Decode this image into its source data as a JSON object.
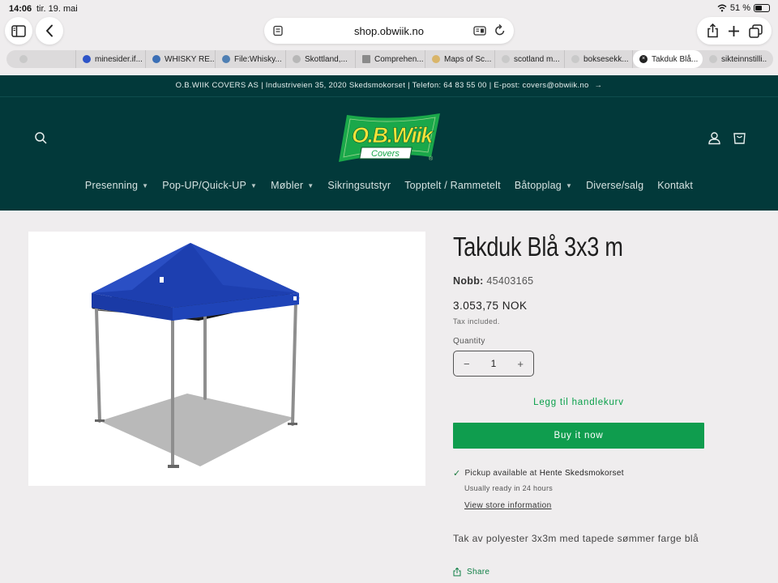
{
  "status_bar": {
    "time": "14:06",
    "date": "tir. 19. mai",
    "battery": "51 %"
  },
  "browser": {
    "url": "shop.obwiik.no",
    "tabs": [
      {
        "label": "",
        "icon": "blank-favicon"
      },
      {
        "label": "minesider.if...",
        "icon": "if-favicon"
      },
      {
        "label": "WHISKY RE...",
        "icon": "wordpress-favicon"
      },
      {
        "label": "File:Whisky...",
        "icon": "wikimedia-favicon"
      },
      {
        "label": "Skottland,...",
        "icon": "h-favicon"
      },
      {
        "label": "Comprehen...",
        "icon": "doc-favicon"
      },
      {
        "label": "Maps of Sc...",
        "icon": "maps-favicon"
      },
      {
        "label": "scotland m...",
        "icon": "google-favicon"
      },
      {
        "label": "boksesekk...",
        "icon": "google-favicon"
      },
      {
        "label": "Takduk Blå...",
        "icon": "close-icon",
        "active": true
      },
      {
        "label": "sikteinnstilli...",
        "icon": "google-favicon"
      }
    ]
  },
  "site": {
    "announcement": "O.B.WIIK COVERS AS | Industriveien 35, 2020 Skedsmokorset | Telefon: 64 83 55 00 | E-post: covers@obwiik.no",
    "logo_text": "O.B.Wiik",
    "logo_subtext": "Covers",
    "logo_mark": "®",
    "nav": [
      {
        "label": "Presenning",
        "dropdown": true
      },
      {
        "label": "Pop-UP/Quick-UP",
        "dropdown": true
      },
      {
        "label": "Møbler",
        "dropdown": true
      },
      {
        "label": "Sikringsutstyr",
        "dropdown": false
      },
      {
        "label": "Topptelt / Rammetelt",
        "dropdown": false
      },
      {
        "label": "Båtopplag",
        "dropdown": true
      },
      {
        "label": "Diverse/salg",
        "dropdown": false
      },
      {
        "label": "Kontakt",
        "dropdown": false
      }
    ],
    "colors": {
      "header_bg": "#02393a",
      "accent_green": "#0f9d4e",
      "logo_green": "#1aa84a",
      "logo_yellow": "#f2e33a"
    }
  },
  "product": {
    "title": "Takduk Blå 3x3 m",
    "sku_label": "Nobb:",
    "sku_value": "45403165",
    "price": "3.053,75 NOK",
    "tax_note": "Tax included.",
    "quantity_label": "Quantity",
    "quantity_value": "1",
    "add_to_cart": "Legg til handlekurv",
    "buy_now": "Buy it now",
    "pickup_prefix": "Pickup available at ",
    "pickup_location": "Hente Skedsmokorset",
    "ready_text": "Usually ready in 24 hours",
    "store_link": "View store information",
    "description": "Tak av polyester 3x3m med tapede sømmer farge blå",
    "share": "Share",
    "canopy_color": "#1d3fb0"
  }
}
